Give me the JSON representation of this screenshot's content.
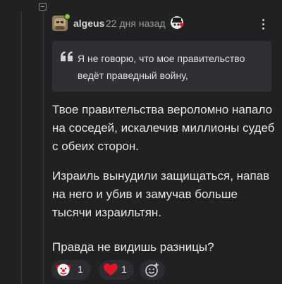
{
  "comment": {
    "author": "algeus",
    "time": "22 дня назад",
    "quote": "Я не говорю, что мое правительство ведёт праведный войну,",
    "paragraphs": [
      "Твое правительства вероломно напало на соседей, искалечив миллионы судеб с обеих сторон.",
      "Израиль вынудили защищаться, напав на него и убив и замучав больше тысячи израильтян.",
      "Правда не видишь разницы?"
    ]
  },
  "reactions": [
    {
      "icon": "clown-icon",
      "count": "1"
    },
    {
      "icon": "heart-icon",
      "count": "1"
    },
    {
      "icon": "add-reaction-icon"
    }
  ],
  "colors": {
    "background": "#202123",
    "quote_bg": "#2f3033",
    "heart": "#e0162b",
    "online": "#8bc34a"
  }
}
